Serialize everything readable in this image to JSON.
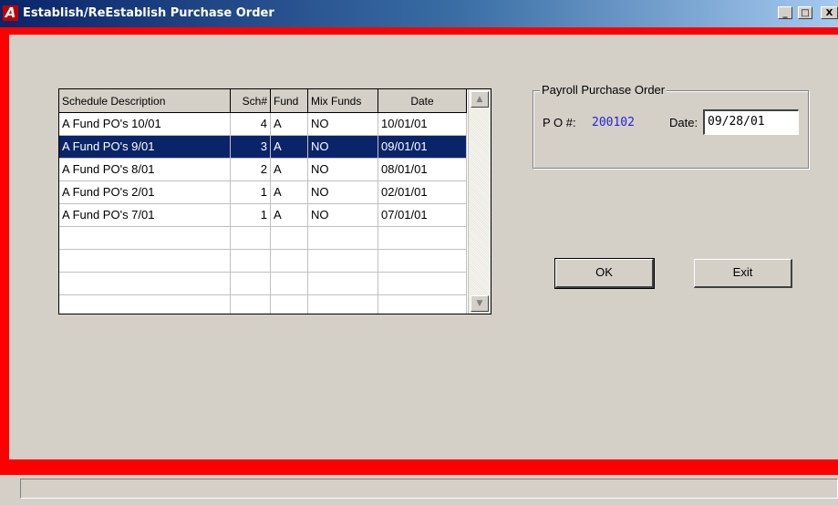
{
  "window": {
    "app_icon": "A",
    "title": "Establish/ReEstablish Purchase Order",
    "minimize_glyph": "_",
    "maximize_glyph": "□",
    "close_glyph": "X"
  },
  "grid": {
    "columns": [
      "Schedule Description",
      "Sch#",
      "Fund",
      "Mix Funds",
      "Date"
    ],
    "rows": [
      {
        "description": "A Fund PO's 10/01",
        "sch": "4",
        "fund": "A",
        "mix": "NO",
        "date": "10/01/01"
      },
      {
        "description": "A Fund PO's 9/01",
        "sch": "3",
        "fund": "A",
        "mix": "NO",
        "date": "09/01/01"
      },
      {
        "description": "A Fund PO's 8/01",
        "sch": "2",
        "fund": "A",
        "mix": "NO",
        "date": "08/01/01"
      },
      {
        "description": "A Fund PO's 2/01",
        "sch": "1",
        "fund": "A",
        "mix": "NO",
        "date": "02/01/01"
      },
      {
        "description": "A Fund PO's 7/01",
        "sch": "1",
        "fund": "A",
        "mix": "NO",
        "date": "07/01/01"
      }
    ],
    "selected_row": 1,
    "scroll_up_glyph": "▲",
    "scroll_down_glyph": "▼"
  },
  "payroll_po": {
    "legend": "Payroll Purchase Order",
    "po_label": "P O #:",
    "po_value": "200102",
    "date_label": "Date:",
    "date_value": "09/28/01"
  },
  "buttons": {
    "ok": "OK",
    "exit": "Exit"
  },
  "colors": {
    "frame": "#ff0000",
    "selection": "#0a246a",
    "po_number": "#2323d7"
  }
}
